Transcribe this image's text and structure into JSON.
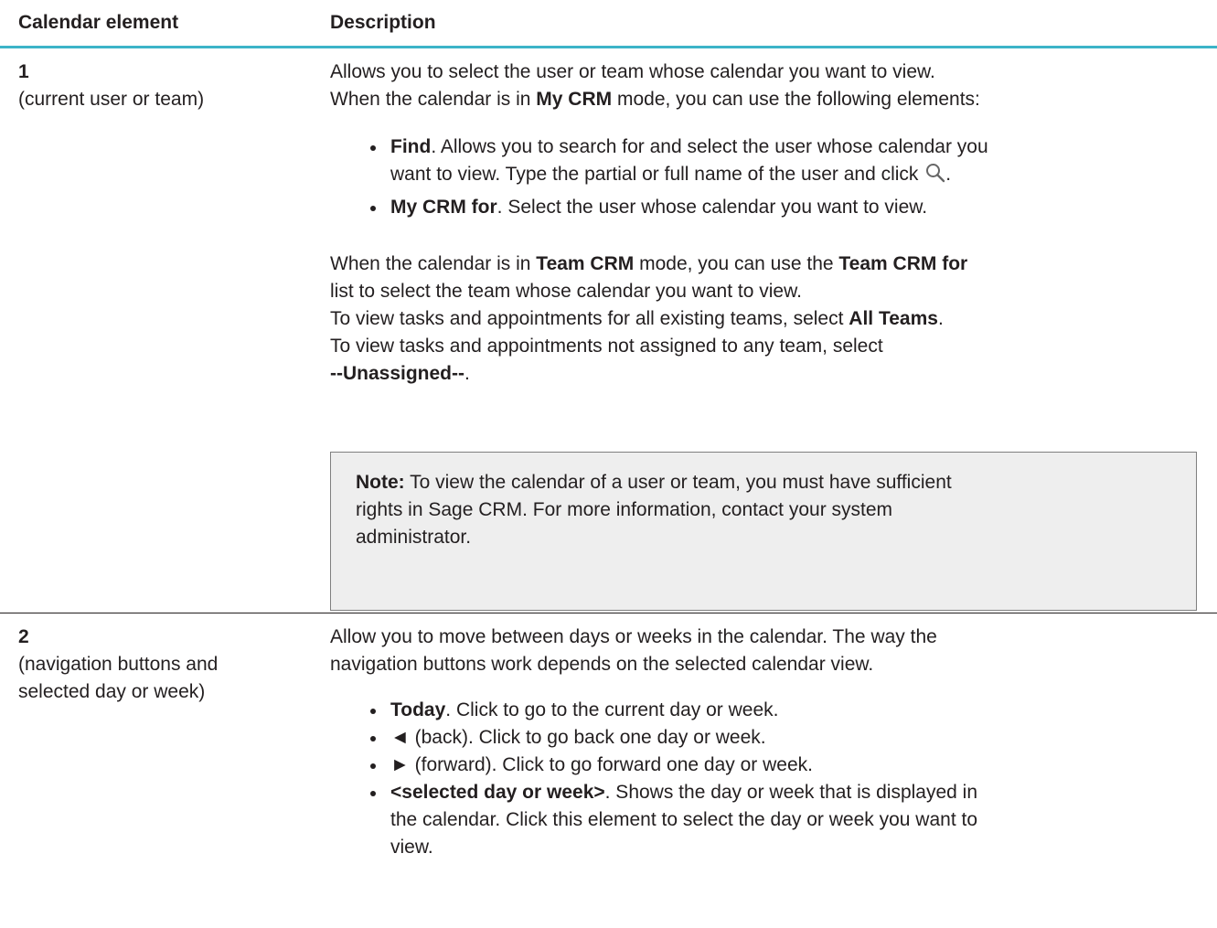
{
  "header": {
    "col1": "Calendar element",
    "col2": "Description"
  },
  "rows": [
    {
      "number": "1",
      "caption": "(current user or team)",
      "intro_line1": "Allows you to select the user or team whose calendar you want to view.",
      "intro_line2_a": "When the calendar is in ",
      "intro_line2_b": "My CRM",
      "intro_line2_c": " mode, you can use the following elements:",
      "bullets": [
        {
          "bold": "Find",
          "text_a": ". Allows you to search for and select the user whose calendar you",
          "text_b": "want to view. Type the partial or full name of the user and click ",
          "text_c": ".",
          "icon": "search-icon"
        },
        {
          "bold": "My CRM for",
          "text_a": ". Select the user whose calendar you want to view."
        }
      ],
      "team_a": "When the calendar is in ",
      "team_b": "Team CRM",
      "team_c": " mode, you can use the ",
      "team_d": "Team CRM for",
      "team_e": "list to select the team whose calendar you want to view.",
      "all_a": "To view tasks and appointments for all existing teams, select ",
      "all_b": "All Teams",
      "all_c": ".",
      "unassigned_a": "To view tasks and appointments not assigned to any team, select",
      "unassigned_b": "--Unassigned--",
      "unassigned_c": ".",
      "note_label": "Note:",
      "note_text_1": " To view the calendar of a user or team, you must have sufficient",
      "note_text_2": "rights in Sage CRM. For more information, contact your system",
      "note_text_3": "administrator."
    },
    {
      "number": "2",
      "caption_line1": "(navigation buttons and",
      "caption_line2": "selected day or week)",
      "intro_line1": "Allow you to move between days or weeks in the calendar. The way the",
      "intro_line2": "navigation buttons work depends on the selected calendar view.",
      "bullets": [
        {
          "bold": "Today",
          "text": ". Click to go to the current day or week."
        },
        {
          "plain": "◄ (back). Click to go back one day or week."
        },
        {
          "plain": "► (forward). Click to go forward one day or week."
        },
        {
          "bold": "<selected day or week>",
          "text": ". Shows the day or week that is displayed in",
          "text_2": "the calendar. Click this element to select the day or week you want to",
          "text_3": "view."
        }
      ]
    }
  ]
}
